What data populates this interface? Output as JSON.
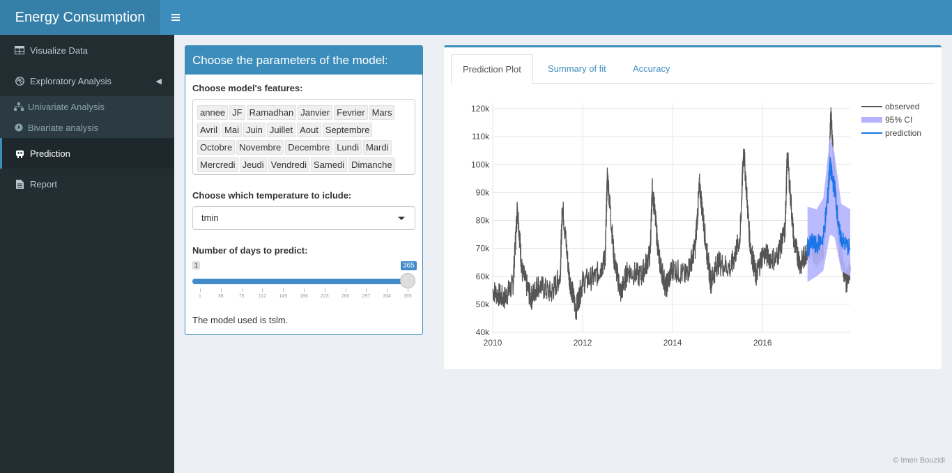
{
  "app": {
    "title": "Energy Consumption"
  },
  "sidebar": {
    "items": [
      {
        "label": "Visualize Data",
        "icon": "table-icon"
      },
      {
        "label": "Exploratory Analysis",
        "icon": "dribbble-icon"
      },
      {
        "label": "Prediction",
        "icon": "robot-icon"
      },
      {
        "label": "Report",
        "icon": "file-icon"
      }
    ],
    "subitems": [
      {
        "label": "Univariate Analysis",
        "icon": "sitemap-icon"
      },
      {
        "label": "Bivariate analysis",
        "icon": "compass-icon"
      }
    ]
  },
  "params": {
    "title": "Choose the parameters of the model:",
    "features_label": "Choose model's features:",
    "features": [
      "annee",
      "JF",
      "Ramadhan",
      "Janvier",
      "Fevrier",
      "Mars",
      "Avril",
      "Mai",
      "Juin",
      "Juillet",
      "Aout",
      "Septembre",
      "Octobre",
      "Novembre",
      "Decembre",
      "Lundi",
      "Mardi",
      "Mercredi",
      "Jeudi",
      "Vendredi",
      "Samedi",
      "Dimanche"
    ],
    "temp_label": "Choose which temperature to iclude:",
    "temp_value": "tmin",
    "days_label": "Number of days to predict:",
    "slider_min": "1",
    "slider_value": "365",
    "slider_ticks": [
      "1",
      "38",
      "75",
      "112",
      "149",
      "186",
      "223",
      "260",
      "297",
      "334",
      "365"
    ],
    "model_text": "The model used is tslm."
  },
  "tabs": [
    "Prediction Plot",
    "Summary of fit",
    "Accuracy"
  ],
  "colors": {
    "accent": "#3c8dbc",
    "observed": "#555555",
    "ci": "#b3b3ff",
    "prediction": "#1a75e8"
  },
  "chart_data": {
    "type": "line",
    "title": "",
    "xlabel": "",
    "ylabel": "",
    "x_ticks": [
      "2010",
      "2012",
      "2014",
      "2016"
    ],
    "y_ticks": [
      "40k",
      "50k",
      "60k",
      "70k",
      "80k",
      "90k",
      "100k",
      "110k",
      "120k"
    ],
    "xlim": [
      2010.0,
      2017.95
    ],
    "ylim": [
      40000,
      122000
    ],
    "legend_position": "top-right",
    "series": [
      {
        "name": "observed",
        "points": [
          [
            2010.0,
            55000
          ],
          [
            2010.25,
            52000
          ],
          [
            2010.45,
            57000
          ],
          [
            2010.55,
            85000
          ],
          [
            2010.65,
            62000
          ],
          [
            2010.85,
            52000
          ],
          [
            2011.0,
            57000
          ],
          [
            2011.3,
            54000
          ],
          [
            2011.5,
            60000
          ],
          [
            2011.55,
            86000
          ],
          [
            2011.7,
            60000
          ],
          [
            2011.85,
            48000
          ],
          [
            2012.0,
            58000
          ],
          [
            2012.3,
            60000
          ],
          [
            2012.5,
            66000
          ],
          [
            2012.55,
            97000
          ],
          [
            2012.7,
            66000
          ],
          [
            2012.85,
            54000
          ],
          [
            2013.0,
            62000
          ],
          [
            2013.3,
            60000
          ],
          [
            2013.5,
            68000
          ],
          [
            2013.55,
            92000
          ],
          [
            2013.7,
            66000
          ],
          [
            2013.85,
            56000
          ],
          [
            2014.0,
            63000
          ],
          [
            2014.3,
            60000
          ],
          [
            2014.5,
            70000
          ],
          [
            2014.6,
            93000
          ],
          [
            2014.75,
            70000
          ],
          [
            2014.85,
            58000
          ],
          [
            2015.0,
            65000
          ],
          [
            2015.3,
            63000
          ],
          [
            2015.5,
            74000
          ],
          [
            2015.58,
            106000
          ],
          [
            2015.72,
            72000
          ],
          [
            2015.85,
            60000
          ],
          [
            2016.0,
            68000
          ],
          [
            2016.3,
            66000
          ],
          [
            2016.5,
            76000
          ],
          [
            2016.55,
            104000
          ],
          [
            2016.7,
            72000
          ],
          [
            2016.85,
            64000
          ],
          [
            2017.0,
            70000
          ],
          [
            2017.2,
            68000
          ],
          [
            2017.35,
            70000
          ],
          [
            2017.45,
            90000
          ],
          [
            2017.52,
            118000
          ],
          [
            2017.58,
            100000
          ],
          [
            2017.7,
            72000
          ],
          [
            2017.85,
            58000
          ],
          [
            2017.95,
            62000
          ]
        ]
      },
      {
        "name": "95% CI",
        "lower": [
          [
            2017.0,
            58000
          ],
          [
            2017.2,
            60000
          ],
          [
            2017.35,
            62000
          ],
          [
            2017.5,
            75000
          ],
          [
            2017.6,
            74000
          ],
          [
            2017.75,
            62000
          ],
          [
            2017.95,
            60000
          ]
        ],
        "upper": [
          [
            2017.0,
            85000
          ],
          [
            2017.2,
            84000
          ],
          [
            2017.35,
            88000
          ],
          [
            2017.5,
            110000
          ],
          [
            2017.6,
            104000
          ],
          [
            2017.75,
            86000
          ],
          [
            2017.95,
            84000
          ]
        ]
      },
      {
        "name": "prediction",
        "points": [
          [
            2017.0,
            70000
          ],
          [
            2017.1,
            72000
          ],
          [
            2017.2,
            71000
          ],
          [
            2017.35,
            74000
          ],
          [
            2017.45,
            88000
          ],
          [
            2017.5,
            100000
          ],
          [
            2017.55,
            95000
          ],
          [
            2017.62,
            90000
          ],
          [
            2017.7,
            76000
          ],
          [
            2017.8,
            72000
          ],
          [
            2017.95,
            70000
          ]
        ]
      }
    ]
  },
  "footer": "© Imen Bouzidi"
}
